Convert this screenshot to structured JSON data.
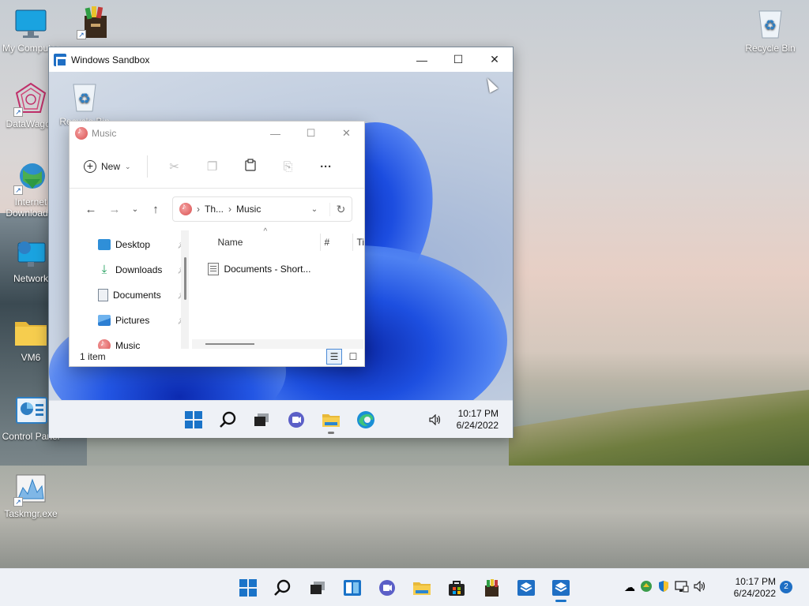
{
  "desktop": {
    "icons": [
      {
        "label": "My Computer",
        "name": "my-computer"
      },
      {
        "label": "",
        "name": "archive-app"
      },
      {
        "label": "DataWagon",
        "name": "datawagon"
      },
      {
        "label": "Internet Download...",
        "name": "internet-download-manager"
      },
      {
        "label": "Network",
        "name": "network"
      },
      {
        "label": "VM6",
        "name": "vm6-folder"
      },
      {
        "label": "Control Panel",
        "name": "control-panel"
      },
      {
        "label": "Taskmgr.exe",
        "name": "taskmgr"
      },
      {
        "label": "Recycle Bin",
        "name": "recycle-bin"
      }
    ]
  },
  "sandbox": {
    "title": "Windows Sandbox",
    "minimize": "—",
    "maximize": "☐",
    "close": "✕",
    "recycle_label": "Recycle Bin",
    "clock_time": "10:17 PM",
    "clock_date": "6/24/2022"
  },
  "explorer": {
    "title": "Music",
    "new_label": "New",
    "breadcrumb": [
      "Th...",
      "Music"
    ],
    "nav_items": [
      {
        "label": "Desktop",
        "icon": "desktop-icon",
        "color": "#2f8fd8"
      },
      {
        "label": "Downloads",
        "icon": "download-icon",
        "color": "#1e9e5a"
      },
      {
        "label": "Documents",
        "icon": "documents-icon",
        "color": "#7a8796"
      },
      {
        "label": "Pictures",
        "icon": "pictures-icon",
        "color": "#2d7fd3"
      },
      {
        "label": "Music",
        "icon": "music-icon",
        "color": "#d94f4f"
      }
    ],
    "columns": [
      "Name",
      "#",
      "Ti"
    ],
    "files": [
      {
        "name": "Documents - Short..."
      }
    ],
    "status": "1 item"
  },
  "taskbar": {
    "clock_time": "10:17 PM",
    "clock_date": "6/24/2022",
    "notification_count": "2"
  }
}
